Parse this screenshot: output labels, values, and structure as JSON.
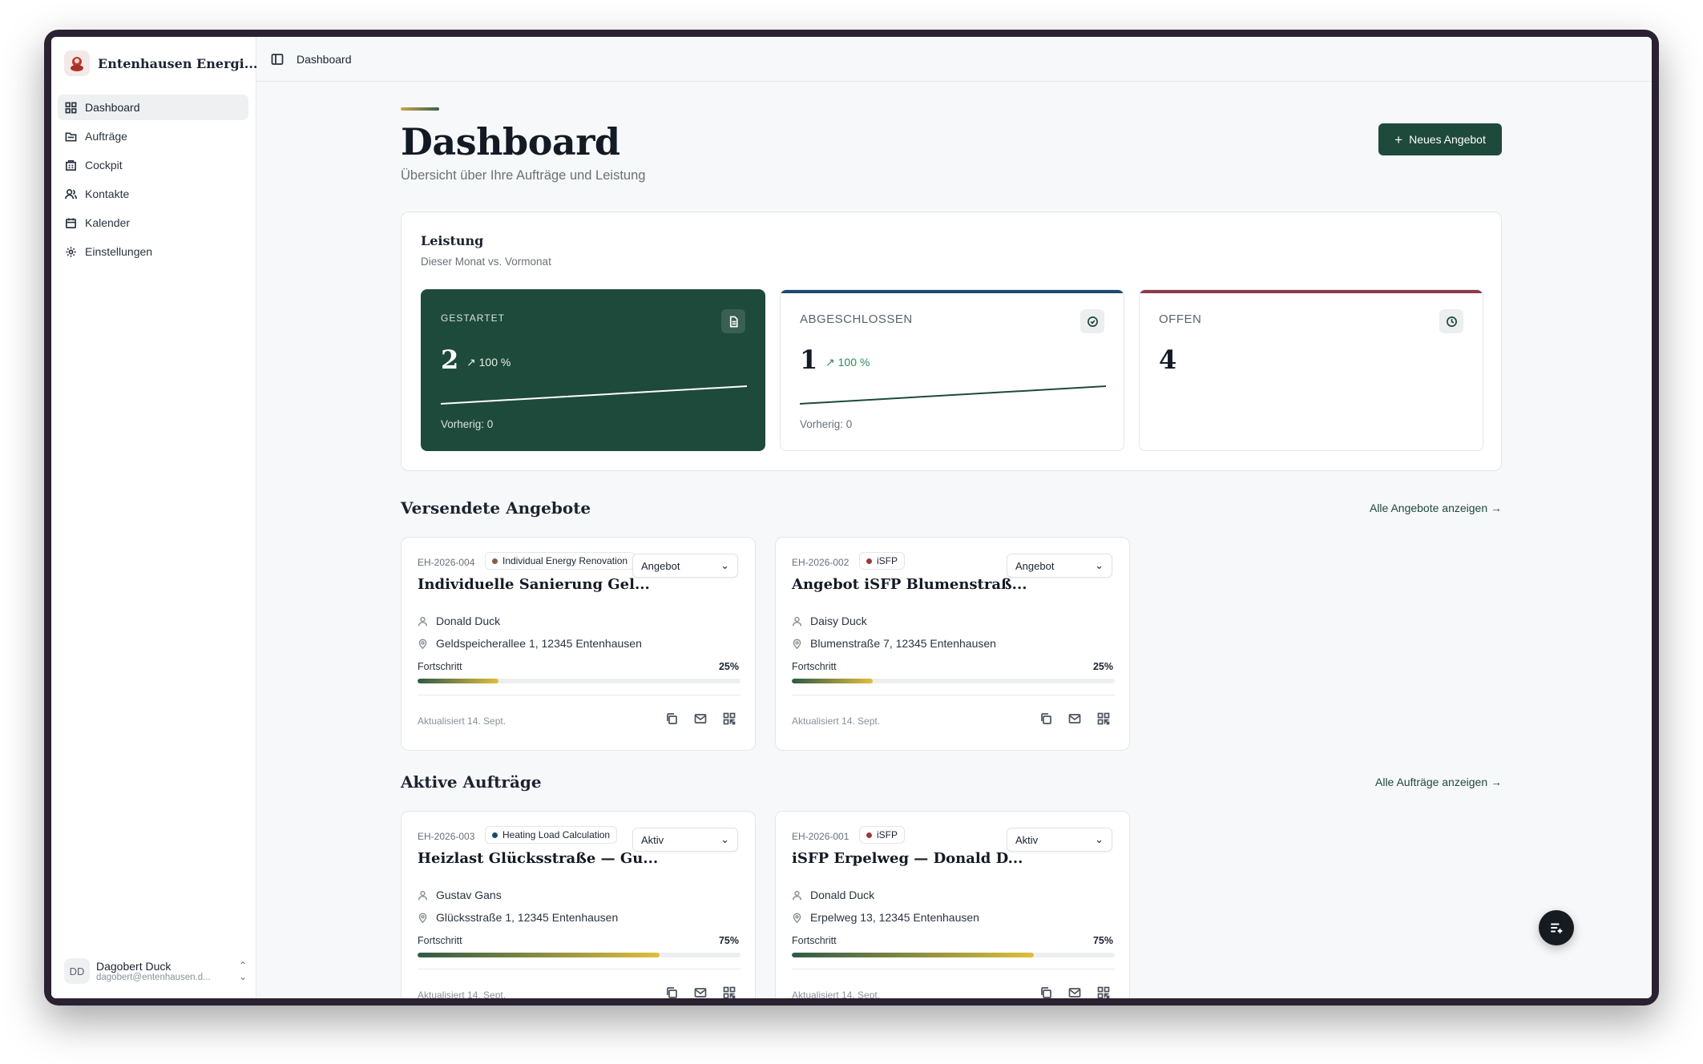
{
  "app": {
    "title": "Entenhausen Energi..."
  },
  "sidebar": {
    "items": [
      {
        "label": "Dashboard",
        "icon": "dashboard-icon"
      },
      {
        "label": "Aufträge",
        "icon": "folder-icon"
      },
      {
        "label": "Cockpit",
        "icon": "building-icon"
      },
      {
        "label": "Kontakte",
        "icon": "users-icon"
      },
      {
        "label": "Kalender",
        "icon": "calendar-icon"
      },
      {
        "label": "Einstellungen",
        "icon": "gear-icon"
      }
    ],
    "active": "Dashboard"
  },
  "user": {
    "initials": "DD",
    "name": "Dagobert Duck",
    "email": "dagobert@entenhausen.d..."
  },
  "topbar": {
    "breadcrumb": "Dashboard"
  },
  "page": {
    "title": "Dashboard",
    "subtitle": "Übersicht über Ihre Aufträge und Leistung",
    "new_button": "Neues Angebot"
  },
  "performance": {
    "title": "Leistung",
    "subtitle": "Dieser Monat vs. Vormonat",
    "kpis": [
      {
        "label": "GESTARTET",
        "value": "2",
        "trend": "↗ 100 %",
        "previous": "Vorherig: 0",
        "icon": "document-icon"
      },
      {
        "label": "ABGESCHLOSSEN",
        "value": "1",
        "trend": "↗ 100 %",
        "previous": "Vorherig: 0",
        "icon": "check-circle-icon"
      },
      {
        "label": "OFFEN",
        "value": "4",
        "icon": "clock-icon"
      }
    ]
  },
  "sections": {
    "offers": {
      "title": "Versendete Angebote",
      "link": "Alle Angebote anzeigen →"
    },
    "orders": {
      "title": "Aktive Aufträge",
      "link": "Alle Aufträge anzeigen →"
    }
  },
  "progress_label": "Fortschritt",
  "offers": [
    {
      "id": "EH-2026-004",
      "tag": "Individual Energy Renovation",
      "tag_color": "#8b5a4a",
      "status": "Angebot",
      "title": "Individuelle Sanierung Gel...",
      "contact": "Donald Duck",
      "address": "Geldspeicherallee 1, 12345 Entenhausen",
      "progress_text": "25%",
      "progress": 0.25,
      "updated": "Aktualisiert 14. Sept."
    },
    {
      "id": "EH-2026-002",
      "tag": "iSFP",
      "tag_color": "#9a3a3a",
      "status": "Angebot",
      "title": "Angebot iSFP Blumenstraß...",
      "contact": "Daisy Duck",
      "address": "Blumenstraße 7, 12345 Entenhausen",
      "progress_text": "25%",
      "progress": 0.25,
      "updated": "Aktualisiert 14. Sept."
    }
  ],
  "orders": [
    {
      "id": "EH-2026-003",
      "tag": "Heating Load Calculation",
      "tag_color": "#1e4a6b",
      "status": "Aktiv",
      "title": "Heizlast Glücksstraße — Gu...",
      "contact": "Gustav Gans",
      "address": "Glücksstraße 1, 12345 Entenhausen",
      "progress_text": "75%",
      "progress": 0.75,
      "updated": "Aktualisiert 14. Sept."
    },
    {
      "id": "EH-2026-001",
      "tag": "iSFP",
      "tag_color": "#9a3a3a",
      "status": "Aktiv",
      "title": "iSFP Erpelweg — Donald D...",
      "contact": "Donald Duck",
      "address": "Erpelweg 13, 12345 Entenhausen",
      "progress_text": "75%",
      "progress": 0.75,
      "updated": "Aktualisiert 14. Sept."
    }
  ],
  "colors": {
    "brand": "#1e4a3b",
    "kpi2_accent": "#1e4a6b",
    "kpi3_accent": "#8b3a4a",
    "progress_start": "#2f5a47",
    "progress_end": "#e0be3a"
  }
}
